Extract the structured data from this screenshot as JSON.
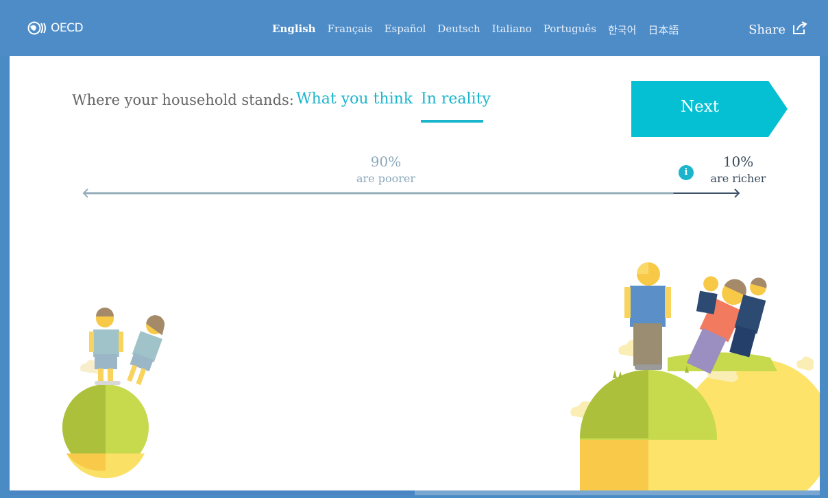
{
  "header": {
    "logo_text": "OECD",
    "languages": [
      {
        "label": "English",
        "active": true
      },
      {
        "label": "Français",
        "active": false
      },
      {
        "label": "Español",
        "active": false
      },
      {
        "label": "Deutsch",
        "active": false
      },
      {
        "label": "Italiano",
        "active": false
      },
      {
        "label": "Português",
        "active": false
      },
      {
        "label": "한국어",
        "active": false
      },
      {
        "label": "日本語",
        "active": false
      }
    ],
    "share_label": "Share"
  },
  "main": {
    "stands_label": "Where your household stands:",
    "tabs": [
      {
        "label": "What you think",
        "active": false
      },
      {
        "label": "In reality",
        "active": true
      }
    ],
    "next_label": "Next",
    "poorer_percent": "90%",
    "poorer_label": "are poorer",
    "richer_percent": "10%",
    "richer_label": "are richer",
    "info_label": "i",
    "position_fraction": 0.9
  },
  "progress": {
    "fraction": 0.5
  },
  "colors": {
    "brand_blue": "#4e8cc8",
    "accent_teal": "#1ab5cc",
    "planet_green": "#c5d94f",
    "planet_yellow": "#fde36a"
  }
}
